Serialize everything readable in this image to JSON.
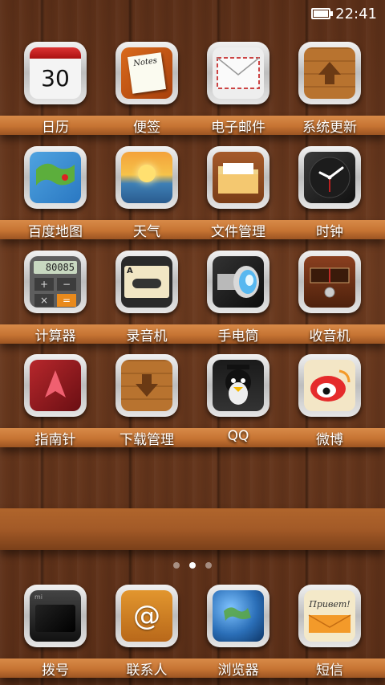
{
  "status_bar": {
    "time": "22:41",
    "battery_icon": "battery-icon",
    "battery_level": 1.0
  },
  "rows": [
    [
      {
        "label": "日历",
        "icon": "calendar-icon",
        "day": "30"
      },
      {
        "label": "便签",
        "icon": "notes-icon",
        "note_title": "Notes"
      },
      {
        "label": "电子邮件",
        "icon": "mail-icon"
      },
      {
        "label": "系统更新",
        "icon": "update-icon"
      }
    ],
    [
      {
        "label": "百度地图",
        "icon": "map-icon"
      },
      {
        "label": "天气",
        "icon": "weather-icon"
      },
      {
        "label": "文件管理",
        "icon": "folder-icon"
      },
      {
        "label": "时钟",
        "icon": "clock-icon"
      }
    ],
    [
      {
        "label": "计算器",
        "icon": "calculator-icon",
        "display": "80085"
      },
      {
        "label": "录音机",
        "icon": "cassette-icon",
        "side": "A"
      },
      {
        "label": "手电筒",
        "icon": "flashlight-icon"
      },
      {
        "label": "收音机",
        "icon": "radio-icon"
      }
    ],
    [
      {
        "label": "指南针",
        "icon": "compass-icon"
      },
      {
        "label": "下载管理",
        "icon": "download-icon"
      },
      {
        "label": "QQ",
        "icon": "qq-penguin-icon"
      },
      {
        "label": "微博",
        "icon": "weibo-icon"
      }
    ]
  ],
  "pages": {
    "count": 3,
    "active": 1
  },
  "dock": [
    {
      "label": "拨号",
      "icon": "phone-icon",
      "brand": "mi"
    },
    {
      "label": "联系人",
      "icon": "contacts-icon"
    },
    {
      "label": "浏览器",
      "icon": "globe-icon"
    },
    {
      "label": "短信",
      "icon": "sms-icon",
      "greeting": "Привет!"
    }
  ],
  "colors": {
    "wood_dark": "#5b2f18",
    "shelf": "#c67433",
    "label": "#ffffff"
  }
}
